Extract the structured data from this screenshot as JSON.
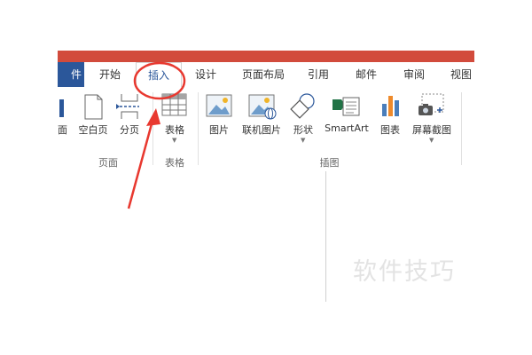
{
  "tabs": [
    {
      "label": "件",
      "active": false
    },
    {
      "label": "开始",
      "active": false
    },
    {
      "label": "插入",
      "active": true
    },
    {
      "label": "设计",
      "active": false
    },
    {
      "label": "页面布局",
      "active": false
    },
    {
      "label": "引用",
      "active": false
    },
    {
      "label": "邮件",
      "active": false
    },
    {
      "label": "审阅",
      "active": false
    },
    {
      "label": "视图",
      "active": false
    }
  ],
  "ribbon": {
    "pages_group": {
      "label": "页面",
      "buttons": {
        "cover_partial": "面",
        "blank_page": "空白页",
        "page_break": "分页"
      }
    },
    "table_group": {
      "label": "表格",
      "buttons": {
        "table": "表格"
      }
    },
    "illustrations_group": {
      "label": "插图",
      "buttons": {
        "pictures": "图片",
        "online_pictures": "联机图片",
        "shapes": "形状",
        "smartart": "SmartArt",
        "chart": "图表",
        "screenshot": "屏幕截图"
      }
    }
  },
  "watermark": "软件技巧",
  "colors": {
    "title_bar": "#d24b3c",
    "file_tab": "#2b579a",
    "annotation": "#e8382f",
    "chart_blue": "#4a7ebb",
    "chart_orange": "#ee8a2b",
    "smartart_green": "#217346"
  },
  "annotations": [
    "red-circle-around-insert-tab",
    "red-arrow-pointing-to-insert-tab"
  ]
}
